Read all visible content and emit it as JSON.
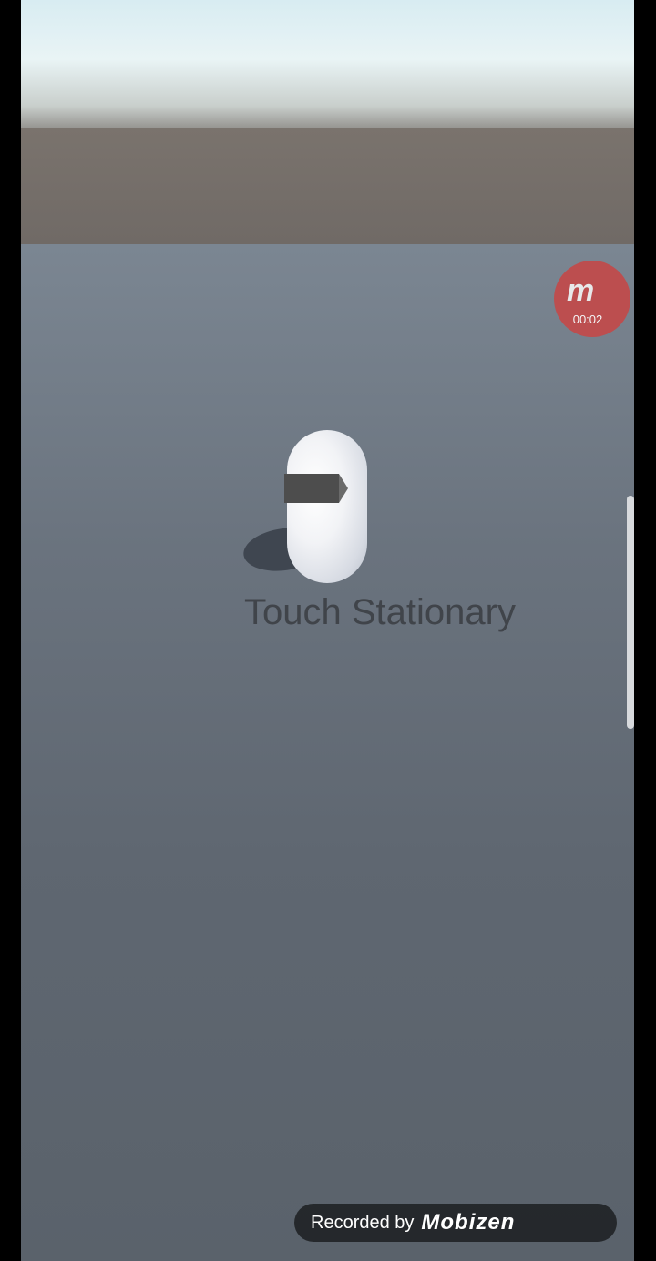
{
  "scene": {
    "status_text": "Touch Stationary"
  },
  "recorder": {
    "badge_logo": "m",
    "timer": "00:02",
    "watermark_text": "Recorded by",
    "watermark_brand": "Mobizen"
  },
  "colors": {
    "sky_top": "#d8ecf2",
    "horizon": "#7a736d",
    "ground": "#6a737e",
    "record_red": "#c24a4a",
    "label_text": "#3a3d42"
  },
  "icons": {
    "recorder_badge": "mobizen-record-icon",
    "player": "capsule-player-icon"
  }
}
